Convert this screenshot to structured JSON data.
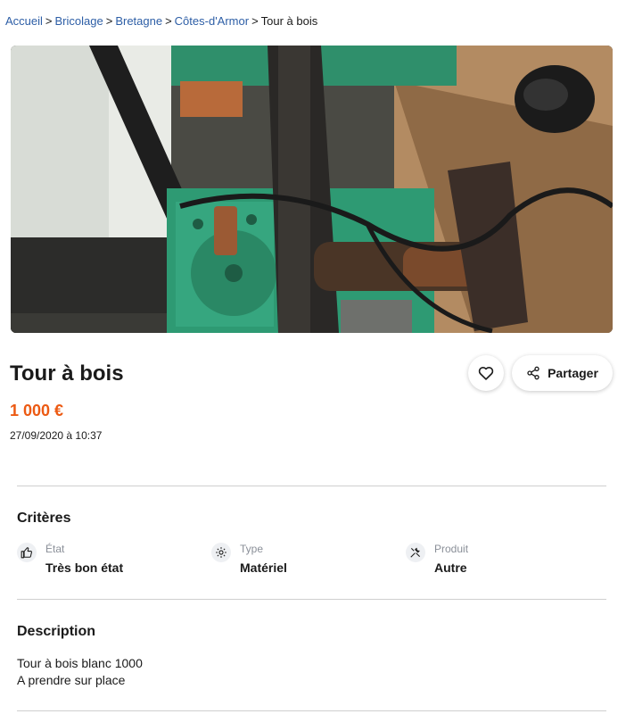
{
  "breadcrumb": {
    "items": [
      "Accueil",
      "Bricolage",
      "Bretagne",
      "Côtes-d'Armor"
    ],
    "separator": ">",
    "current": "Tour à bois"
  },
  "listing": {
    "title": "Tour à bois",
    "price": "1 000 €",
    "date": "27/09/2020 à 10:37",
    "share_label": "Partager"
  },
  "criteria": {
    "heading": "Critères",
    "items": [
      {
        "label": "État",
        "value": "Très bon état",
        "icon": "thumbs-up-icon"
      },
      {
        "label": "Type",
        "value": "Matériel",
        "icon": "gear-icon"
      },
      {
        "label": "Produit",
        "value": "Autre",
        "icon": "tools-icon"
      }
    ]
  },
  "description": {
    "heading": "Description",
    "lines": [
      "Tour à bois blanc 1000",
      "A prendre sur place"
    ]
  },
  "colors": {
    "link": "#2d5ea6",
    "price": "#ec5a13",
    "muted": "#8a8f98"
  }
}
